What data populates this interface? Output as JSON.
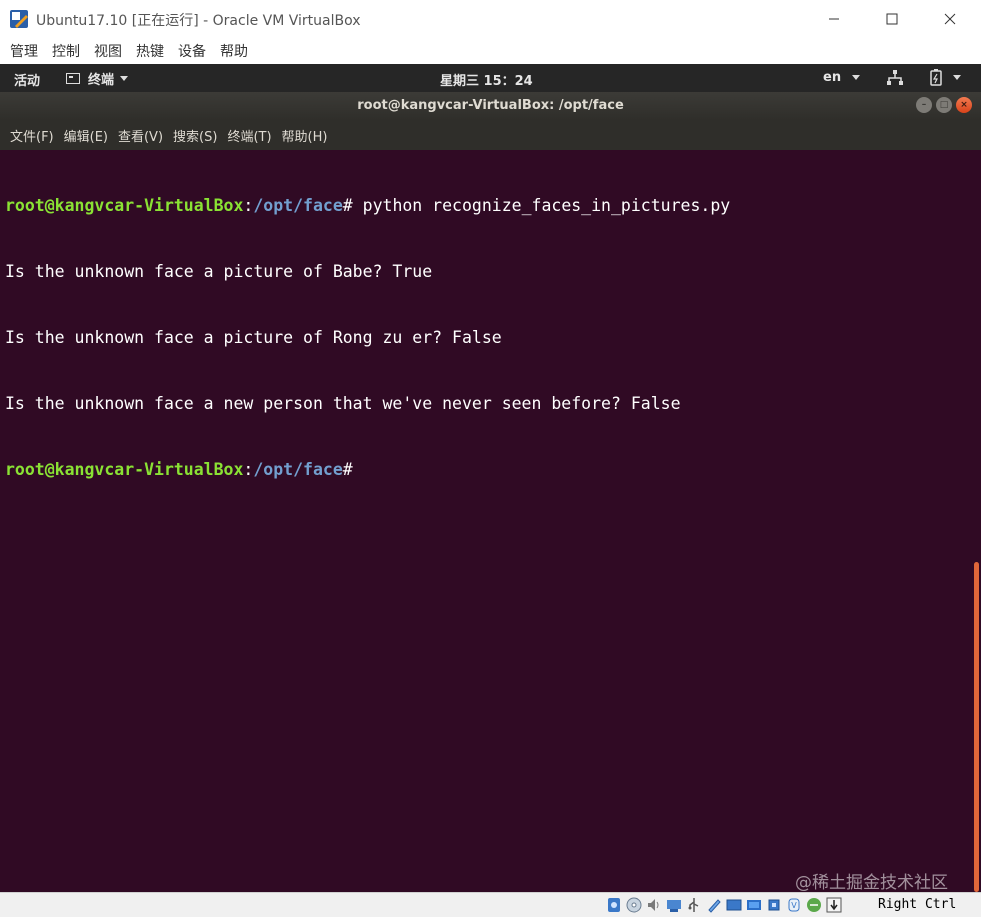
{
  "host_window": {
    "title": "Ubuntu17.10 [正在运行] - Oracle VM VirtualBox",
    "icons": {
      "app": "virtualbox-icon",
      "minimize": "minimize-icon",
      "maximize": "maximize-icon",
      "close": "close-icon"
    }
  },
  "vbox_menu": {
    "items": [
      {
        "label": "管理"
      },
      {
        "label": "控制"
      },
      {
        "label": "视图"
      },
      {
        "label": "热键"
      },
      {
        "label": "设备"
      },
      {
        "label": "帮助"
      }
    ]
  },
  "gnome_topbar": {
    "activities": "活动",
    "app_menu": "终端",
    "clock": "星期三 15：24",
    "input_lang": "en",
    "icons": {
      "app": "terminal-icon",
      "network": "network-icon",
      "power": "power-icon"
    }
  },
  "terminal": {
    "window_title": "root@kangvcar-VirtualBox: /opt/face",
    "menu": [
      {
        "label": "文件(F)"
      },
      {
        "label": "编辑(E)"
      },
      {
        "label": "查看(V)"
      },
      {
        "label": "搜索(S)"
      },
      {
        "label": "终端(T)"
      },
      {
        "label": "帮助(H)"
      }
    ],
    "prompt_user": "root@kangvcar-VirtualBox",
    "prompt_colon": ":",
    "prompt_path": "/opt/face",
    "prompt_symbol": "#",
    "command": " python recognize_faces_in_pictures.py",
    "output": [
      "Is the unknown face a picture of Babe? True",
      "Is the unknown face a picture of Rong zu er? False",
      "Is the unknown face a new person that we've never seen before? False"
    ],
    "colors": {
      "background": "#300a24",
      "user": "#8ae234",
      "path": "#729fcf",
      "scrollbar": "#e0673a"
    }
  },
  "watermark": "@稀土掘金技术社区",
  "status_bar": {
    "host_key": "Right Ctrl",
    "icons": [
      "hard-disk-icon",
      "optical-drive-icon",
      "audio-icon",
      "network-adapter-icon",
      "usb-icon",
      "shared-folders-icon",
      "display-icon",
      "video-capture-icon",
      "cpu-icon",
      "mouse-integration-icon",
      "keyboard-icon"
    ]
  }
}
